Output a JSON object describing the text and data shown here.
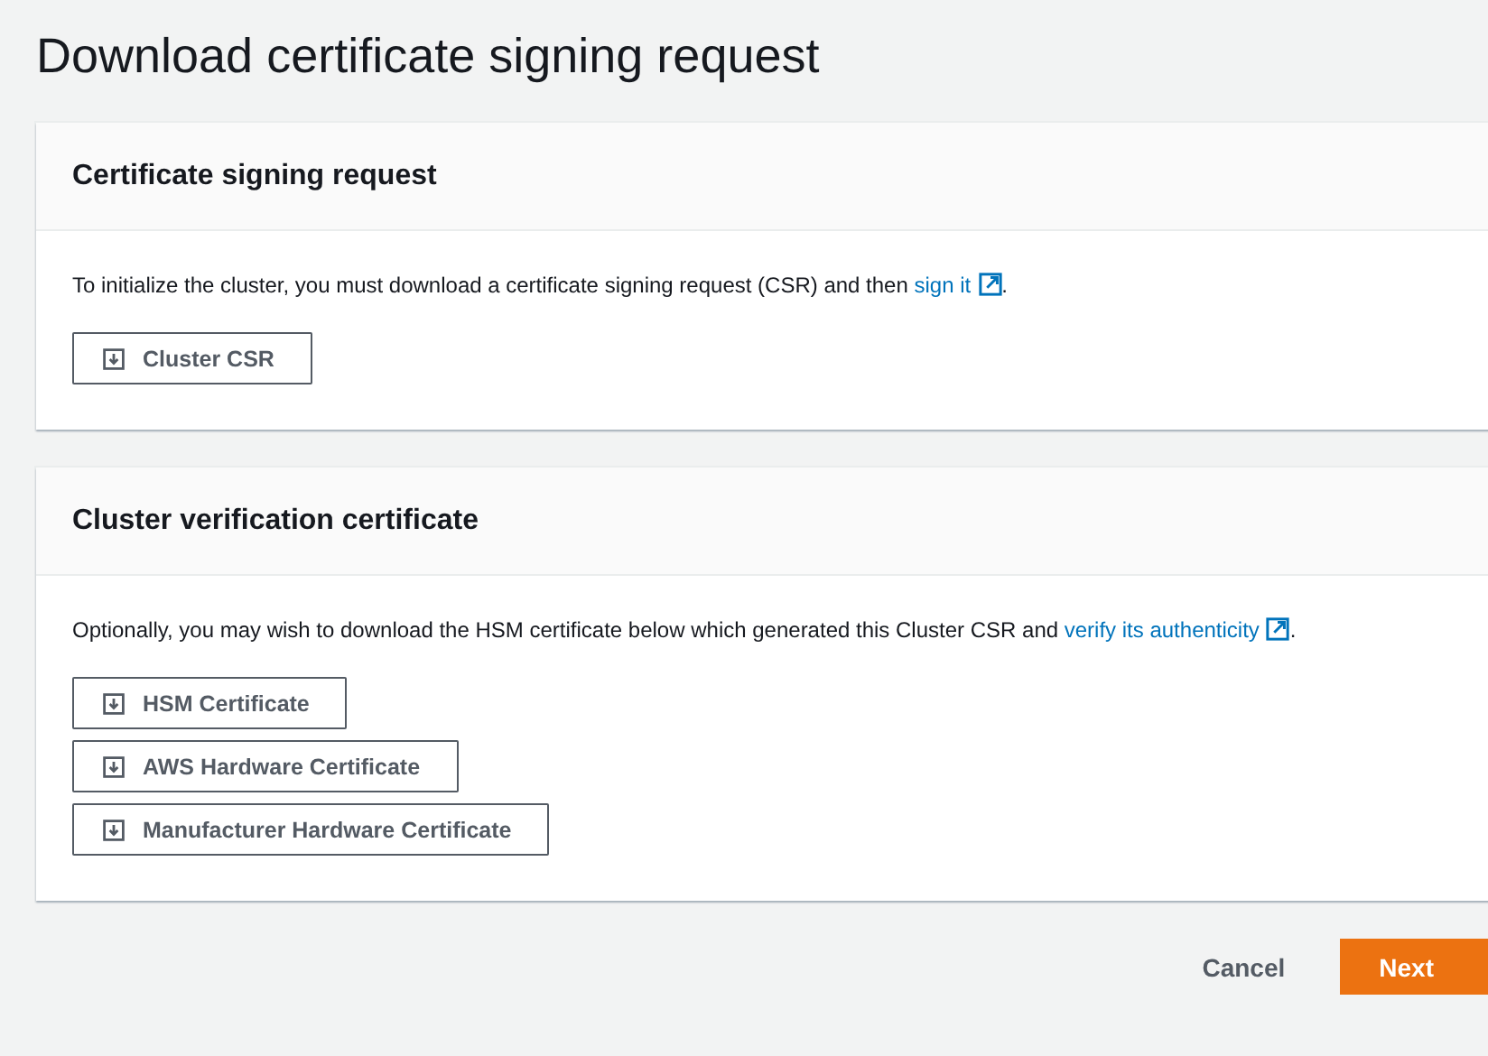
{
  "title": "Download certificate signing request",
  "panels": [
    {
      "heading": "Certificate signing request",
      "text": "To initialize the cluster, you must download a certificate signing request (CSR) and then ",
      "link": "sign it",
      "after": ".",
      "buttons": [
        "Cluster CSR"
      ]
    },
    {
      "heading": "Cluster verification certificate",
      "text": "Optionally, you may wish to download the HSM certificate below which generated this Cluster CSR and ",
      "link": "verify its authenticity",
      "after": ".",
      "buttons": [
        "HSM Certificate",
        "AWS Hardware Certificate",
        "Manufacturer Hardware Certificate"
      ]
    }
  ],
  "footer": {
    "cancel": "Cancel",
    "next": "Next"
  }
}
